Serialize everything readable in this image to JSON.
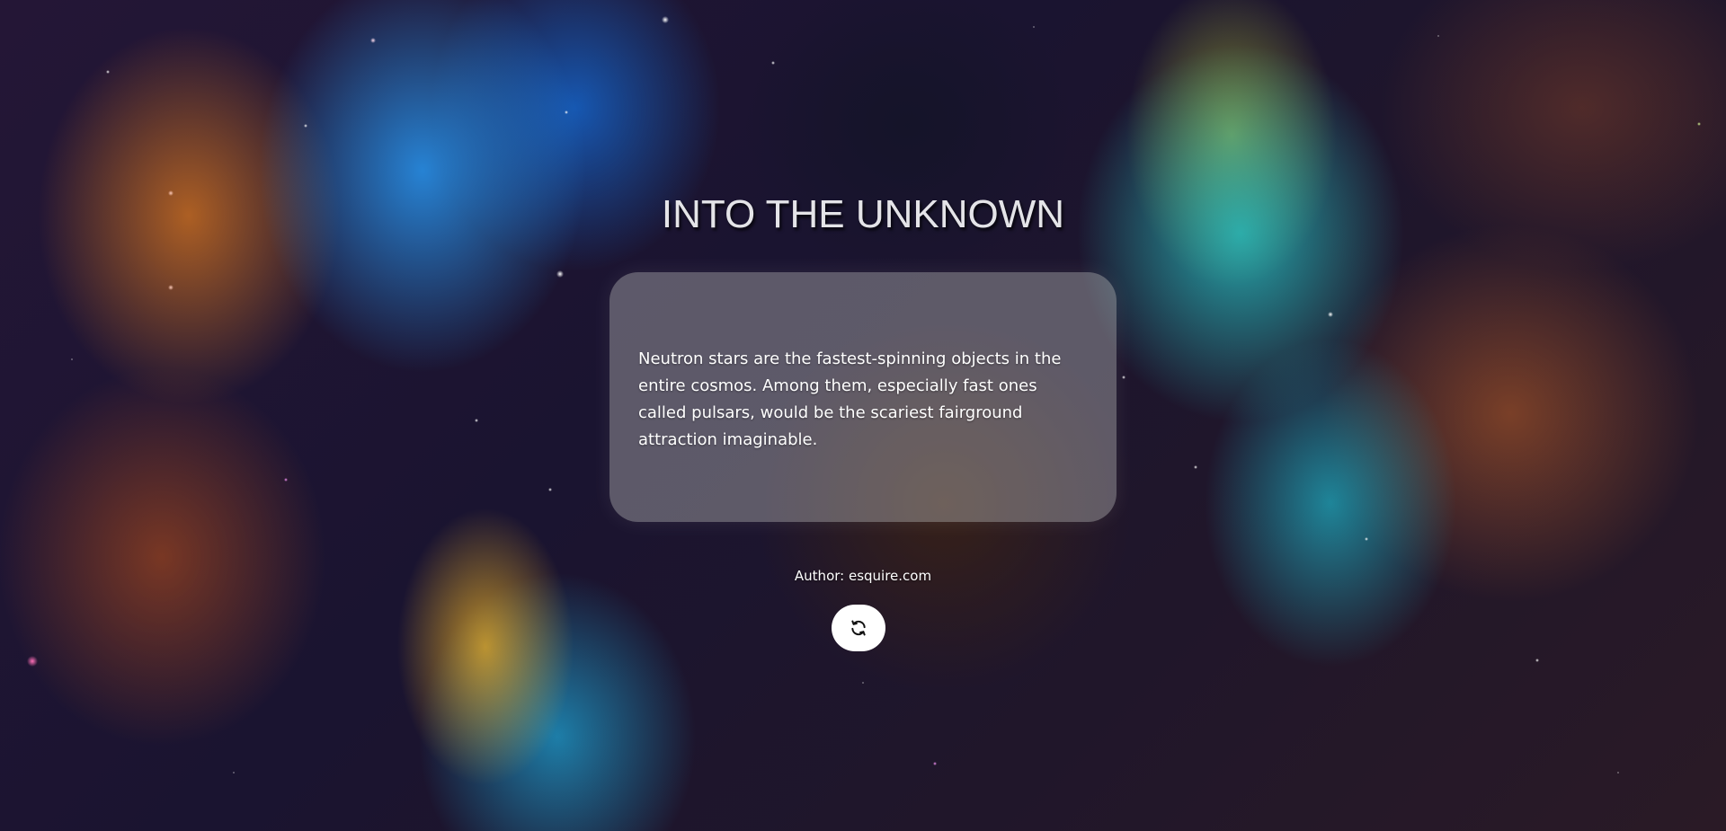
{
  "page": {
    "title": "INTO THE UNKNOWN"
  },
  "quote_card": {
    "text": "Neutron stars are the fastest-spinning objects in the entire cosmos. Among them, especially fast ones called pulsars, would be the scariest fairground attraction imaginable."
  },
  "author": {
    "label": "Author: esquire.com"
  },
  "refresh_button": {
    "icon": "refresh-icon"
  },
  "colors": {
    "title_text": "#e4e4e8",
    "card_background": "rgba(185,185,185,0.42)",
    "button_background": "#ffffff"
  }
}
